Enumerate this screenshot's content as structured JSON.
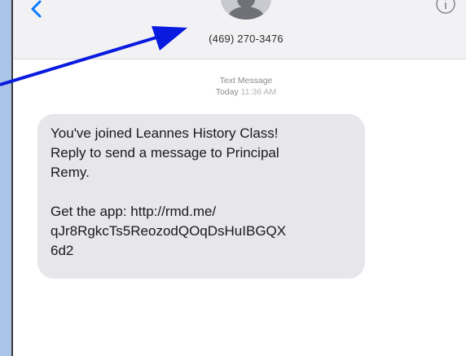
{
  "header": {
    "contact_number": "(469) 270-3476"
  },
  "thread": {
    "service_label": "Text Message",
    "day_label": "Today",
    "time_label": "11:36 AM"
  },
  "message": {
    "paragraph1": "You've joined Leannes History Class!\nReply to send a message to Principal\nRemy.",
    "paragraph2": "Get the app: http://rmd.me/\nqJr8RgkcTs5ReozodQOqDsHuIBGQX\n6d2"
  },
  "icons": {
    "back": "chevron-left-icon",
    "avatar": "avatar-icon",
    "info": "info-icon"
  },
  "colors": {
    "accent": "#0a7aff",
    "annotation_arrow": "#0a1be0",
    "bubble": "#e6e6eb",
    "page_background": "#a9c4e6"
  }
}
